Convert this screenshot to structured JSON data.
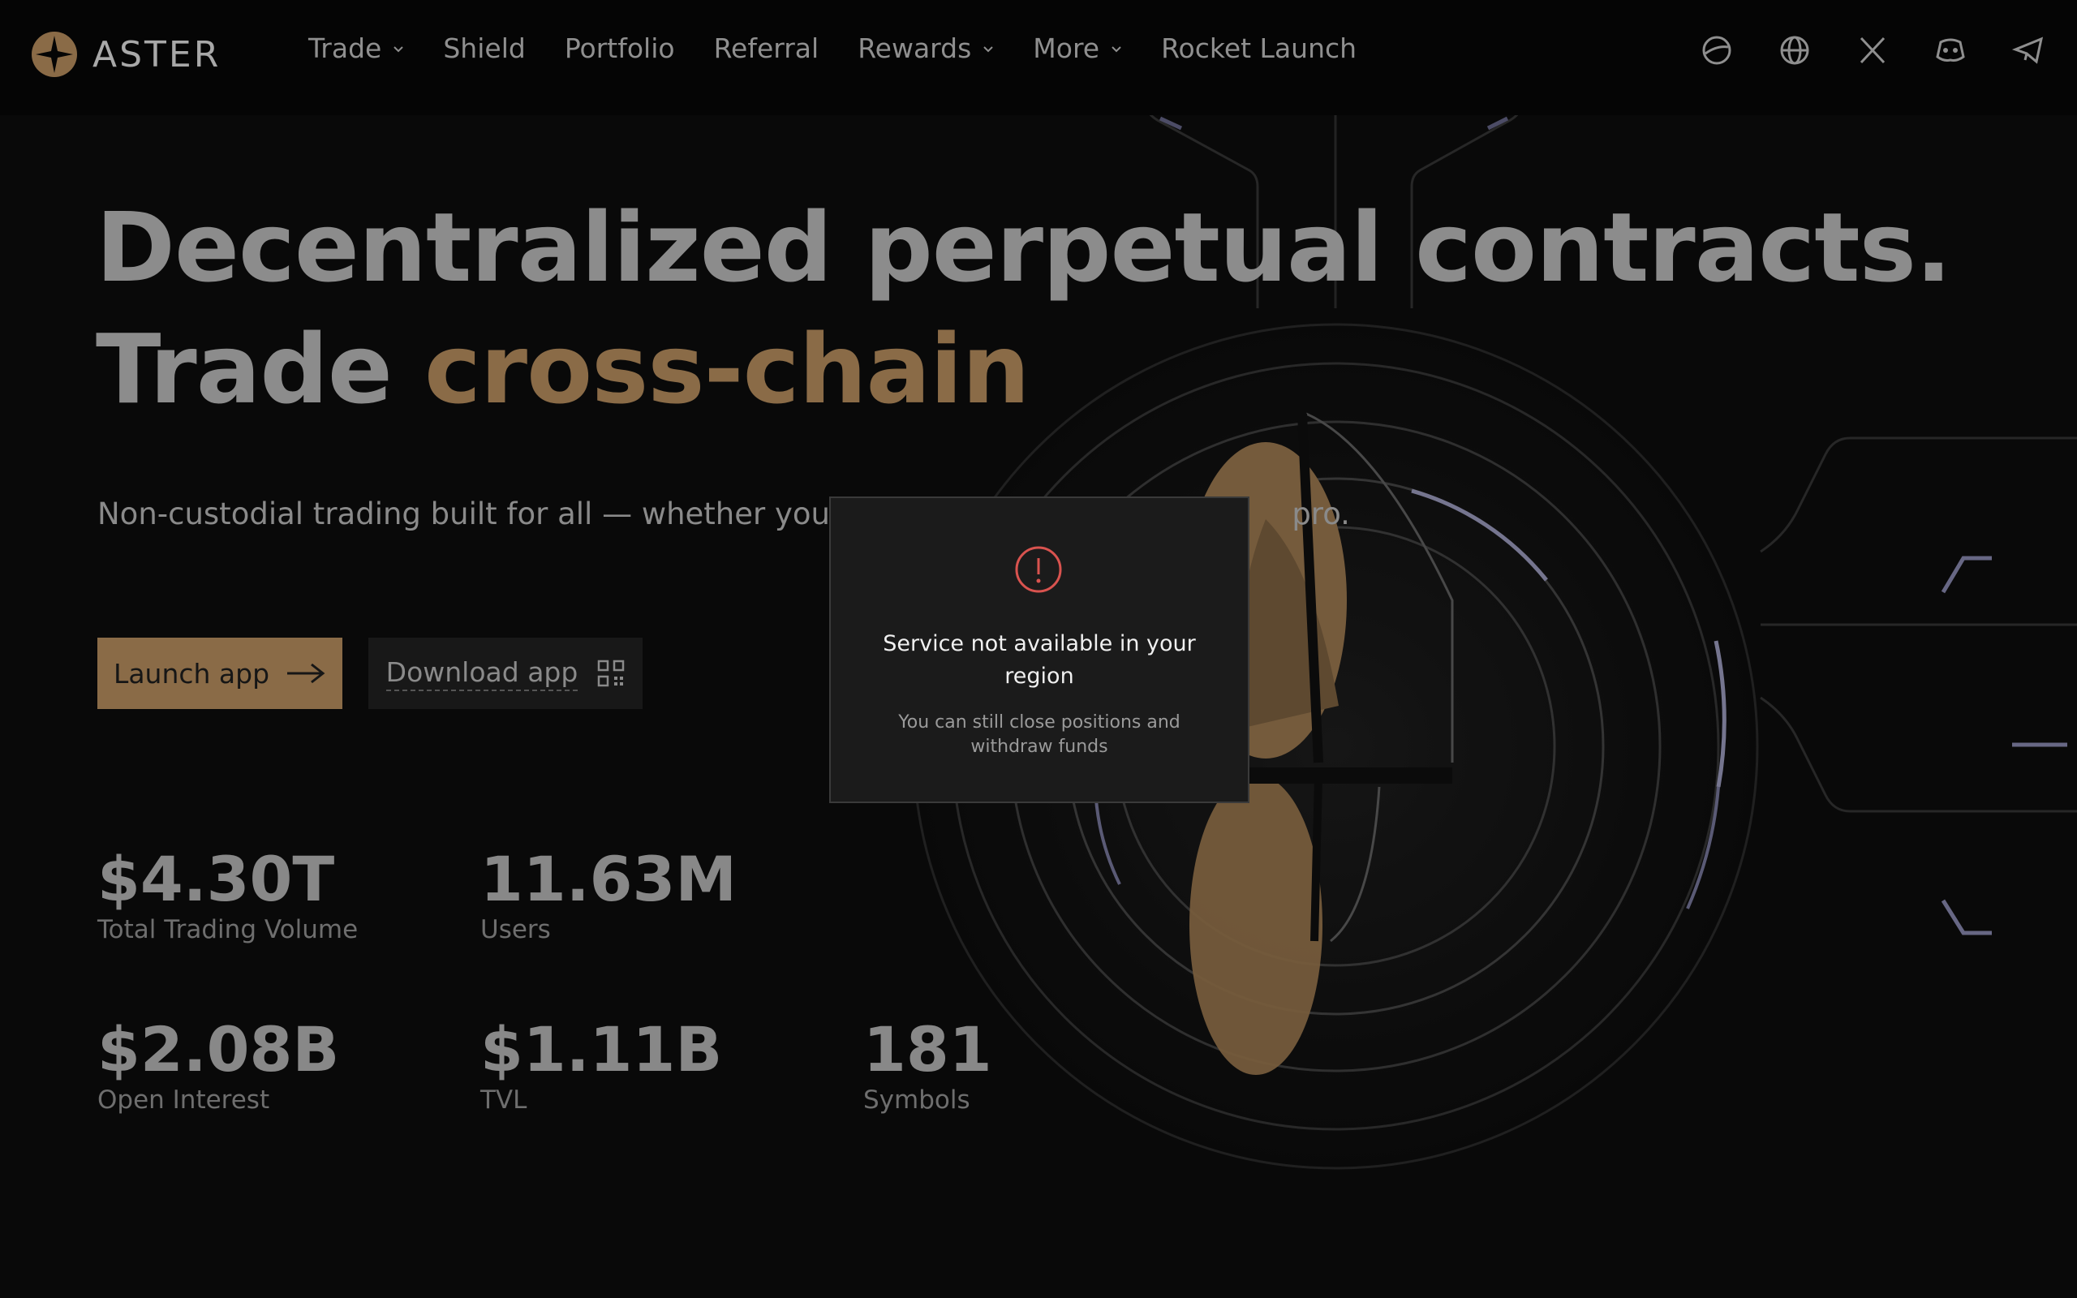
{
  "brand": {
    "name": "ASTER",
    "accent_color": "#8a6b47"
  },
  "nav": {
    "items": [
      {
        "label": "Trade",
        "has_dropdown": true
      },
      {
        "label": "Shield",
        "has_dropdown": false
      },
      {
        "label": "Portfolio",
        "has_dropdown": false
      },
      {
        "label": "Referral",
        "has_dropdown": false
      },
      {
        "label": "Rewards",
        "has_dropdown": true
      },
      {
        "label": "More",
        "has_dropdown": true
      },
      {
        "label": "Rocket Launch",
        "has_dropdown": false
      }
    ],
    "icons": [
      "theme-toggle-icon",
      "globe-icon",
      "x-twitter-icon",
      "discord-icon",
      "telegram-icon"
    ]
  },
  "hero": {
    "headline_line1": "Decentralized perpetual contracts.",
    "headline_line2_prefix": "Trade ",
    "headline_line2_accent": "cross-chain",
    "subtitle_start": "Non-custodial trading built for all — whether you're",
    "subtitle_end": "pro."
  },
  "buttons": {
    "launch": "Launch app",
    "download": "Download app"
  },
  "stats": [
    {
      "value": "$4.30T",
      "label": "Total Trading Volume"
    },
    {
      "value": "11.63M",
      "label": "Users"
    },
    {
      "value": "$2.08B",
      "label": "Open Interest"
    },
    {
      "value": "$1.11B",
      "label": "TVL"
    },
    {
      "value": "181",
      "label": "Symbols"
    }
  ],
  "modal": {
    "title": "Service not available in your region",
    "description": "You can still close positions and withdraw funds",
    "icon": "warning-icon",
    "icon_color": "#d9534f"
  }
}
